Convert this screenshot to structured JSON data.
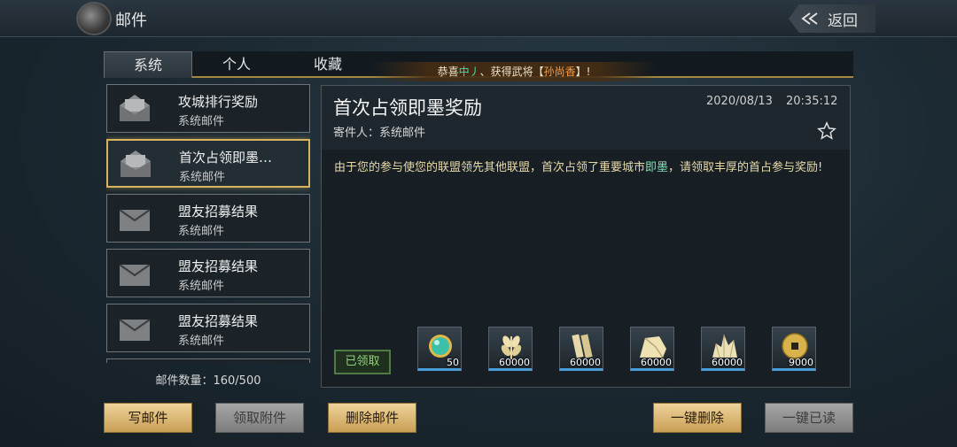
{
  "header": {
    "title": "邮件",
    "back_label": "返回"
  },
  "tabs": [
    {
      "label": "系统",
      "active": true
    },
    {
      "label": "个人",
      "active": false
    },
    {
      "label": "收藏",
      "active": false
    }
  ],
  "marquee": {
    "prefix": "恭喜",
    "player": "中丿",
    "middle": "、获得武将【",
    "general": "孙尚香",
    "suffix": "】!"
  },
  "mail_list": [
    {
      "subject": "攻城排行奖励",
      "sender": "系统邮件",
      "icon": "envelope-open-icon"
    },
    {
      "subject": "首次占领即墨…",
      "sender": "系统邮件",
      "icon": "envelope-open-icon",
      "selected": true
    },
    {
      "subject": "盟友招募结果",
      "sender": "系统邮件",
      "icon": "envelope-closed-icon"
    },
    {
      "subject": "盟友招募结果",
      "sender": "系统邮件",
      "icon": "envelope-closed-icon"
    },
    {
      "subject": "盟友招募结果",
      "sender": "系统邮件",
      "icon": "envelope-closed-icon"
    }
  ],
  "mail_count": "邮件数量：160/500",
  "detail": {
    "title": "首次占领即墨奖励",
    "sender": "寄件人：系统邮件",
    "date": "2020/08/13",
    "time": "20:35:12",
    "body_before": "由于您的参与使您的联盟领先其他联盟，首次占领了重要城市",
    "body_city": "即墨",
    "body_after": "，请领取丰厚的首占参与奖励!",
    "claimed_label": "已领取",
    "rewards": [
      {
        "name": "jade-orb-icon",
        "qty": "50"
      },
      {
        "name": "wheat-icon",
        "qty": "60000"
      },
      {
        "name": "wood-icon",
        "qty": "60000"
      },
      {
        "name": "stone-icon",
        "qty": "60000"
      },
      {
        "name": "iron-ore-icon",
        "qty": "60000"
      },
      {
        "name": "copper-coin-icon",
        "qty": "9000"
      }
    ]
  },
  "buttons": {
    "write": "写邮件",
    "claim_attach": "领取附件",
    "delete": "删除邮件",
    "delete_all": "一键删除",
    "read_all": "一键已读"
  },
  "colors": {
    "accent_gold": "#d9b45e",
    "reward_bar": "#4a9dd9",
    "body_text": "#e8d9a8",
    "claimed_green": "#8fd27b"
  }
}
